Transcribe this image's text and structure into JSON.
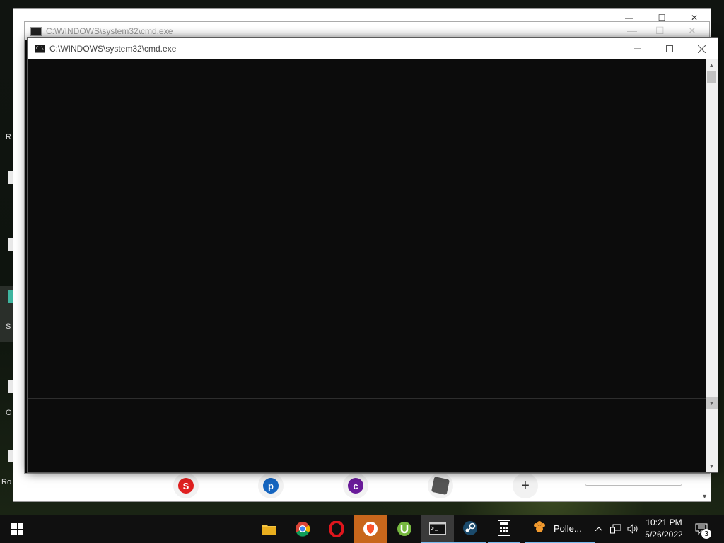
{
  "desktop": {
    "icon_labels": [
      "R",
      "S",
      "O",
      "Ro"
    ]
  },
  "background_window": {
    "search_placeholder": ""
  },
  "ghost_cmd": {
    "title": "C:\\WINDOWS\\system32\\cmd.exe"
  },
  "cmd_window": {
    "title": "C:\\WINDOWS\\system32\\cmd.exe",
    "icon_text": "C:\\",
    "console_text": ""
  },
  "taskbar": {
    "apps": [
      {
        "name": "File Explorer",
        "icon": "folder-icon"
      },
      {
        "name": "Google Chrome",
        "icon": "chrome-icon"
      },
      {
        "name": "Opera",
        "icon": "opera-icon"
      },
      {
        "name": "Brave",
        "icon": "brave-icon"
      },
      {
        "name": "uTorrent",
        "icon": "utorrent-icon"
      },
      {
        "name": "Command Prompt",
        "icon": "cmd-icon"
      },
      {
        "name": "Steam",
        "icon": "steam-icon"
      },
      {
        "name": "Calculator",
        "icon": "calculator-icon"
      }
    ],
    "pinned_app_label": "Polle...",
    "clock_time": "10:21 PM",
    "clock_date": "5/26/2022",
    "notification_count": "3"
  }
}
